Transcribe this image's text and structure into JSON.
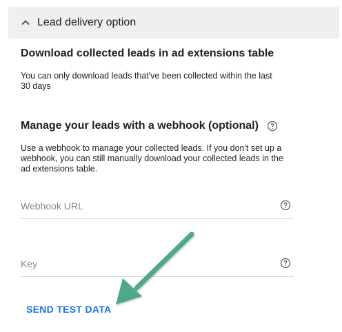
{
  "section": {
    "title": "Lead delivery option",
    "icon": "chevron-up-icon"
  },
  "download": {
    "heading": "Download collected leads in ad extensions table",
    "description": "You can only download leads that've been collected within the last 30 days"
  },
  "webhook": {
    "heading": "Manage your leads with a webhook (optional)",
    "description": "Use a webhook to manage your collected leads. If you don't set up a webhook, you can still manually download your collected leads in the ad extensions table.",
    "help_icon": "help-circle-icon"
  },
  "fields": {
    "webhook_url": {
      "placeholder": "Webhook URL",
      "value": ""
    },
    "key": {
      "placeholder": "Key",
      "value": ""
    }
  },
  "actions": {
    "send_test_data": "SEND TEST DATA"
  },
  "colors": {
    "header_bg": "#efefef",
    "link": "#1a73e8",
    "annotation_arrow": "#4fa88c"
  }
}
